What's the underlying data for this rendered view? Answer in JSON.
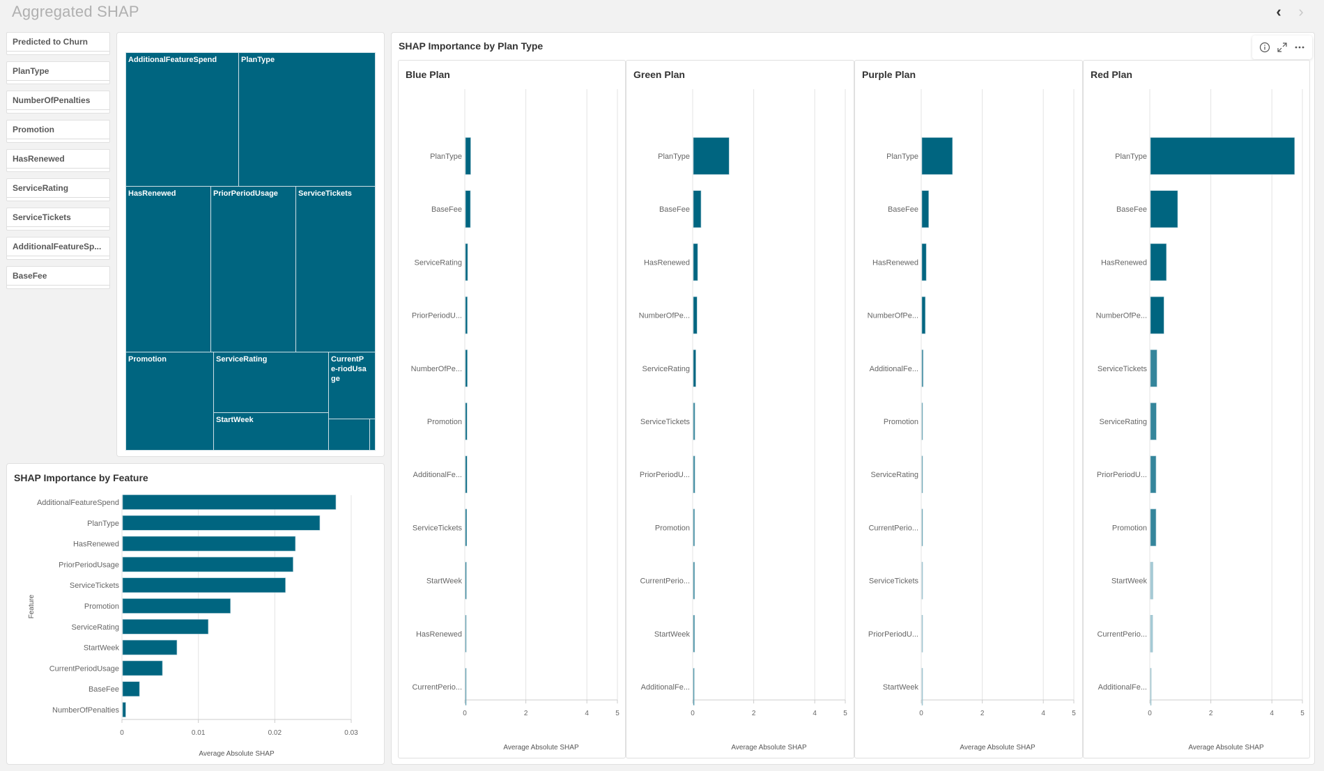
{
  "header": {
    "title": "Aggregated SHAP",
    "prev_icon": "chevron-left-icon",
    "next_icon": "chevron-right-icon"
  },
  "filters": [
    {
      "label": "Predicted to Churn"
    },
    {
      "label": "PlanType"
    },
    {
      "label": "NumberOfPenalties"
    },
    {
      "label": "Promotion"
    },
    {
      "label": "HasRenewed"
    },
    {
      "label": "ServiceRating"
    },
    {
      "label": "ServiceTickets"
    },
    {
      "label": "AdditionalFeatureSp..."
    },
    {
      "label": "BaseFee"
    }
  ],
  "colors": {
    "bar": "#006580",
    "bar_light": "#cfe4ea",
    "grid": "#e3e3e3",
    "axis": "#cccccc"
  },
  "treemap": {
    "cells": [
      {
        "label": "AdditionalFeatureSpend"
      },
      {
        "label": "PlanType"
      },
      {
        "label": "HasRenewed"
      },
      {
        "label": "PriorPeriodUsage"
      },
      {
        "label": "ServiceTickets"
      },
      {
        "label": "Promotion"
      },
      {
        "label": "ServiceRating"
      },
      {
        "label": "StartWeek"
      },
      {
        "label": "CurrentPe-riodUsage"
      },
      {
        "label": ""
      },
      {
        "label": ""
      }
    ]
  },
  "plan_panel": {
    "title": "SHAP Importance by Plan Type",
    "toolbar": {
      "info_icon": "info-icon",
      "expand_icon": "expand-icon",
      "more_icon": "more-icon"
    }
  },
  "chart_data": [
    {
      "type": "bar",
      "orientation": "horizontal",
      "title": "SHAP Importance by Feature",
      "xlabel": "Average Absolute SHAP",
      "ylabel": "Feature",
      "categories": [
        "AdditionalFeatureSpend",
        "PlanType",
        "HasRenewed",
        "PriorPeriodUsage",
        "ServiceTickets",
        "Promotion",
        "ServiceRating",
        "StartWeek",
        "CurrentPeriodUsage",
        "BaseFee",
        "NumberOfPenalties"
      ],
      "values": [
        0.0279,
        0.0258,
        0.0226,
        0.0223,
        0.0213,
        0.0141,
        0.0112,
        0.0071,
        0.0052,
        0.0022,
        0.0004
      ],
      "xlim": [
        0,
        0.03
      ],
      "xticks": [
        "0",
        "0.01",
        "0.02",
        "0.03"
      ],
      "grid": true
    },
    {
      "type": "bar",
      "orientation": "horizontal",
      "title": "Blue Plan",
      "xlabel": "Average Absolute SHAP",
      "categories": [
        "PlanType",
        "BaseFee",
        "ServiceRating",
        "PriorPeriodU...",
        "NumberOfPe...",
        "Promotion",
        "AdditionalFe...",
        "ServiceTickets",
        "StartWeek",
        "HasRenewed",
        "CurrentPerio..."
      ],
      "values": [
        0.17,
        0.16,
        0.07,
        0.06,
        0.06,
        0.05,
        0.05,
        0.04,
        0.03,
        0.02,
        0.01
      ],
      "xlim": [
        0,
        5
      ],
      "xticks": [
        "0",
        "2",
        "4",
        "5"
      ],
      "grid": true
    },
    {
      "type": "bar",
      "orientation": "horizontal",
      "title": "Green Plan",
      "xlabel": "Average Absolute SHAP",
      "categories": [
        "PlanType",
        "BaseFee",
        "HasRenewed",
        "NumberOfPe...",
        "ServiceRating",
        "ServiceTickets",
        "PriorPeriodU...",
        "Promotion",
        "CurrentPerio...",
        "StartWeek",
        "AdditionalFe..."
      ],
      "values": [
        1.17,
        0.25,
        0.14,
        0.12,
        0.08,
        0.05,
        0.05,
        0.04,
        0.04,
        0.04,
        0.03
      ],
      "xlim": [
        0,
        5
      ],
      "xticks": [
        "0",
        "2",
        "4",
        "5"
      ],
      "grid": true
    },
    {
      "type": "bar",
      "orientation": "horizontal",
      "title": "Purple Plan",
      "xlabel": "Average Absolute SHAP",
      "categories": [
        "PlanType",
        "BaseFee",
        "HasRenewed",
        "NumberOfPe...",
        "AdditionalFe...",
        "Promotion",
        "ServiceRating",
        "CurrentPerio...",
        "ServiceTickets",
        "PriorPeriodU...",
        "StartWeek"
      ],
      "values": [
        1.0,
        0.22,
        0.14,
        0.11,
        0.04,
        0.02,
        0.02,
        0.02,
        0.01,
        0.01,
        0.01
      ],
      "xlim": [
        0,
        5
      ],
      "xticks": [
        "0",
        "2",
        "4",
        "5"
      ],
      "grid": true
    },
    {
      "type": "bar",
      "orientation": "horizontal",
      "title": "Red Plan",
      "xlabel": "Average Absolute SHAP",
      "categories": [
        "PlanType",
        "BaseFee",
        "HasRenewed",
        "NumberOfPe...",
        "ServiceTickets",
        "ServiceRating",
        "PriorPeriodU...",
        "Promotion",
        "StartWeek",
        "CurrentPerio...",
        "AdditionalFe..."
      ],
      "values": [
        4.72,
        0.89,
        0.52,
        0.44,
        0.21,
        0.19,
        0.18,
        0.18,
        0.08,
        0.07,
        0.02
      ],
      "xlim": [
        0,
        5
      ],
      "xticks": [
        "0",
        "2",
        "4",
        "5"
      ],
      "grid": true
    }
  ]
}
